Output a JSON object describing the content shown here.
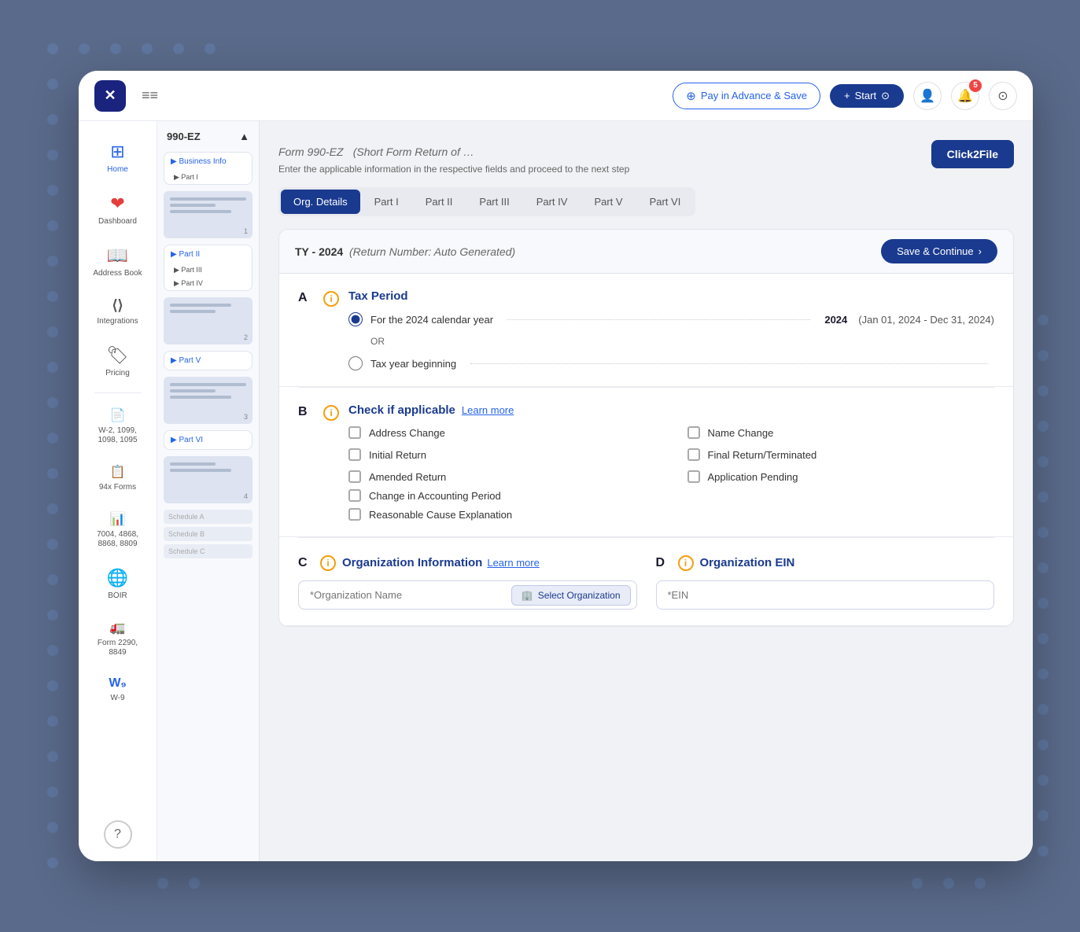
{
  "app": {
    "logo": "✕",
    "hamburger": "≡"
  },
  "topnav": {
    "pay_advance_label": "Pay in Advance & Save",
    "start_label": "Start",
    "notification_count": "5"
  },
  "sidebar": {
    "items": [
      {
        "id": "home",
        "label": "Home",
        "icon": "⊞"
      },
      {
        "id": "dashboard",
        "label": "Dashboard",
        "icon": "❤"
      },
      {
        "id": "address-book",
        "label": "Address Book",
        "icon": "📖"
      },
      {
        "id": "integrations",
        "label": "Integrations",
        "icon": "◇"
      },
      {
        "id": "pricing",
        "label": "Pricing",
        "icon": "🏷"
      },
      {
        "id": "w2",
        "label": "W-2, 1099, 1098, 1095",
        "icon": "📄"
      },
      {
        "id": "94x",
        "label": "94x Forms",
        "icon": "📋"
      },
      {
        "id": "7004",
        "label": "7004, 4868, 8868, 8809",
        "icon": "📊"
      },
      {
        "id": "boir",
        "label": "BOIR",
        "icon": "🌐"
      },
      {
        "id": "2290",
        "label": "Form 2290, 8849",
        "icon": "🚛"
      },
      {
        "id": "w9",
        "label": "W-9",
        "icon": "W₉"
      }
    ]
  },
  "form_tree": {
    "title": "990-EZ",
    "sections": [
      {
        "label": "Business Info",
        "items": [
          "Part I"
        ]
      },
      {
        "label": "Part II",
        "items": [
          "Part III",
          "Part IV"
        ]
      },
      {
        "label": "Part V",
        "items": []
      },
      {
        "label": "Part VI",
        "items": []
      }
    ],
    "pages": [
      "1",
      "2",
      "3",
      "4"
    ]
  },
  "form": {
    "title": "Form 990-EZ",
    "subtitle_italic": "(Short Form Return of …",
    "description": "Enter the applicable information in the respective fields and proceed to the next step",
    "click2file_label": "Click2File",
    "tabs": [
      {
        "id": "org-details",
        "label": "Org. Details",
        "active": true
      },
      {
        "id": "part-i",
        "label": "Part I"
      },
      {
        "id": "part-ii",
        "label": "Part II"
      },
      {
        "id": "part-iii",
        "label": "Part III"
      },
      {
        "id": "part-iv",
        "label": "Part IV"
      },
      {
        "id": "part-v",
        "label": "Part V"
      },
      {
        "id": "part-vi",
        "label": "Part VI"
      }
    ],
    "card": {
      "ty_label": "TY - 2024",
      "return_number": "(Return Number: Auto Generated)",
      "save_continue_label": "Save & Continue"
    },
    "section_a": {
      "letter": "A",
      "title": "Tax Period",
      "option1_label": "For the 2024 calendar year",
      "option1_value": "2024",
      "option1_range": "(Jan 01, 2024 - Dec 31, 2024)",
      "or_text": "OR",
      "option2_label": "Tax year beginning"
    },
    "section_b": {
      "letter": "B",
      "title": "Check if applicable",
      "learn_more": "Learn more",
      "checkboxes": [
        {
          "id": "address-change",
          "label": "Address Change",
          "checked": false
        },
        {
          "id": "name-change",
          "label": "Name Change",
          "checked": false
        },
        {
          "id": "initial-return",
          "label": "Initial Return",
          "checked": false
        },
        {
          "id": "final-return",
          "label": "Final Return/Terminated",
          "checked": false
        },
        {
          "id": "amended-return",
          "label": "Amended Return",
          "checked": false
        },
        {
          "id": "application-pending",
          "label": "Application Pending",
          "checked": false
        },
        {
          "id": "change-accounting",
          "label": "Change in Accounting Period",
          "checked": false
        },
        {
          "id": "reasonable-cause",
          "label": "Reasonable Cause Explanation",
          "checked": false
        }
      ]
    },
    "section_c": {
      "letter": "C",
      "title": "Organization Information",
      "learn_more": "Learn more",
      "org_name_label": "*Organization Name",
      "org_name_placeholder": "",
      "select_org_label": "Select Organization"
    },
    "section_d": {
      "letter": "D",
      "title": "Organization EIN",
      "ein_label": "*EIN",
      "ein_placeholder": ""
    }
  },
  "colors": {
    "primary": "#1a3a8f",
    "accent": "#2563eb",
    "warning": "#f59e0b",
    "danger": "#ef4444"
  }
}
